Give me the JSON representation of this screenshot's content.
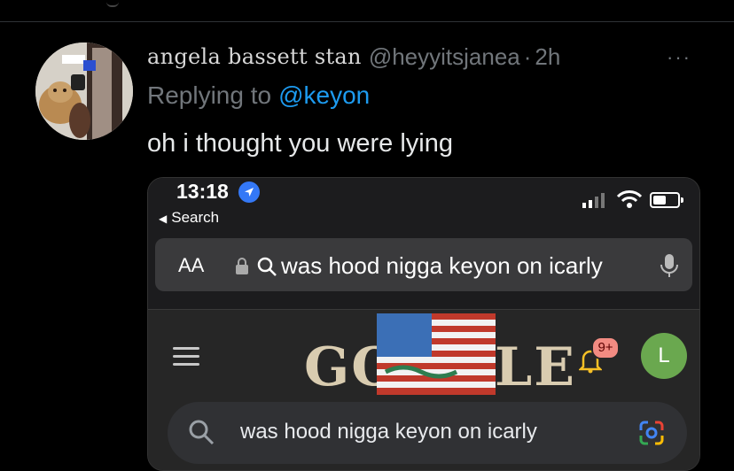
{
  "tweet": {
    "display_name": "angela bassett stan",
    "handle": "@heyyitsjanea",
    "separator": "·",
    "time": "2h",
    "more": "···",
    "replying_prefix": "Replying to",
    "replying_to": "@keyon",
    "text": "oh i thought you were lying"
  },
  "screenshot": {
    "status": {
      "time": "13:18",
      "back_label": "Search"
    },
    "url_bar": {
      "aa_label": "AA",
      "query": "was hood nigga keyon on icarly"
    },
    "google": {
      "logo_text": "GOOGLE",
      "notification_badge": "9+",
      "account_initial": "L",
      "search_query": "was hood nigga keyon on icarly"
    }
  },
  "colors": {
    "link_blue": "#1d9bf0",
    "muted": "#71767b",
    "avatar_green": "#6aa84f",
    "badge_red": "#f28b82"
  }
}
